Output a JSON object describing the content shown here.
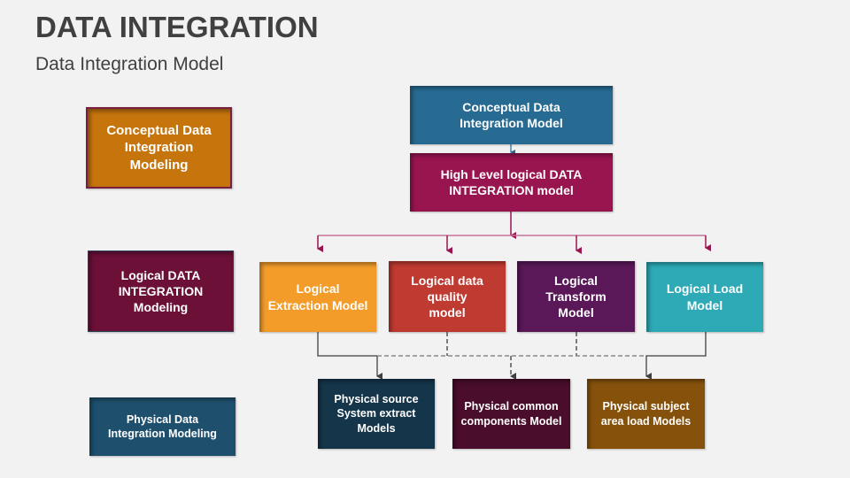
{
  "header": {
    "title": "DATA INTEGRATION",
    "subtitle": "Data Integration Model"
  },
  "levels": [
    {
      "label": "Conceptual Data Integration Modeling",
      "color": "#c5750c",
      "border": "#7a1f3d"
    },
    {
      "label": "Logical DATA INTEGRATION Modeling",
      "color": "#6d1038",
      "border": "#2b3f5c"
    },
    {
      "label": "Physical Data Integration Modeling",
      "color": "#1e506e",
      "border": "#1e506e"
    }
  ],
  "conceptual_model": {
    "label": "Conceptual Data Integration Model",
    "color": "#276b93"
  },
  "high_level_model": {
    "label": "High Level logical DATA INTEGRATION model",
    "color": "#99154f"
  },
  "logical_models": [
    {
      "label": "Logical Extraction Model",
      "color": "#f39c2a"
    },
    {
      "label": "Logical data quality model",
      "color": "#bf3a30"
    },
    {
      "label": "Logical Transform Model",
      "color": "#5a1858"
    },
    {
      "label": "Logical Load Model",
      "color": "#2eaab7"
    }
  ],
  "physical_models": [
    {
      "label": "Physical source System extract Models",
      "color": "#15354a"
    },
    {
      "label": "Physical common components Model",
      "color": "#4a0d2b"
    },
    {
      "label": "Physical subject area load Models",
      "color": "#86520b"
    }
  ],
  "connector_colors": {
    "conceptual_to_high": "#276b93",
    "high_to_logical": "#99154f",
    "logical_to_physical": "#404040",
    "dashed": "#7f7f7f"
  }
}
